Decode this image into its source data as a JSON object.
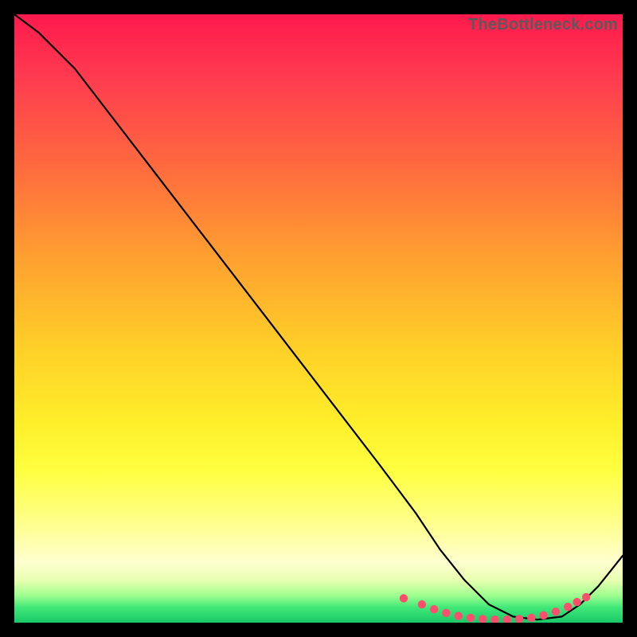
{
  "watermark": "TheBottleneck.com",
  "chart_data": {
    "type": "line",
    "title": "",
    "xlabel": "",
    "ylabel": "",
    "xlim": [
      0,
      100
    ],
    "ylim": [
      0,
      100
    ],
    "series": [
      {
        "name": "curve",
        "x": [
          0,
          4,
          10,
          20,
          30,
          40,
          50,
          60,
          66,
          70,
          74,
          78,
          82,
          86,
          90,
          93,
          96,
          100
        ],
        "y": [
          100,
          97,
          91,
          78,
          65,
          52,
          39,
          26,
          18,
          12,
          7,
          3,
          1,
          0.5,
          1,
          3,
          6,
          11
        ]
      }
    ],
    "markers": {
      "name": "highlight-dots",
      "color": "#ff4d6d",
      "x": [
        64,
        67,
        69,
        71,
        73,
        75,
        77,
        79,
        81,
        83,
        85,
        87,
        89,
        91,
        92.5,
        94
      ],
      "y": [
        4.0,
        3.0,
        2.2,
        1.6,
        1.1,
        0.8,
        0.6,
        0.5,
        0.5,
        0.6,
        0.8,
        1.2,
        1.8,
        2.6,
        3.4,
        4.2
      ]
    }
  }
}
